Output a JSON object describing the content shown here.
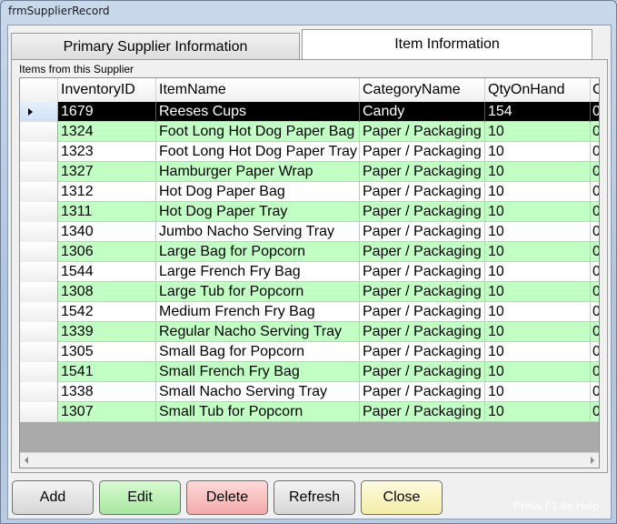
{
  "window": {
    "title": "frmSupplierRecord"
  },
  "tabs": [
    {
      "label": "Primary Supplier Information",
      "active": false
    },
    {
      "label": "Item Information",
      "active": true
    }
  ],
  "group": {
    "label": "Items from this Supplier"
  },
  "grid": {
    "columns": [
      "InventoryID",
      "ItemName",
      "CategoryName",
      "QtyOnHand",
      "C"
    ],
    "rows": [
      [
        "1679",
        "Reeses Cups",
        "Candy",
        "154",
        "0"
      ],
      [
        "1324",
        "Foot Long Hot Dog Paper Bag",
        "Paper / Packaging",
        "10",
        "0"
      ],
      [
        "1323",
        "Foot Long Hot Dog Paper Tray",
        "Paper / Packaging",
        "10",
        "0"
      ],
      [
        "1327",
        "Hamburger Paper Wrap",
        "Paper / Packaging",
        "10",
        "0"
      ],
      [
        "1312",
        "Hot Dog Paper Bag",
        "Paper / Packaging",
        "10",
        "0"
      ],
      [
        "1311",
        "Hot Dog Paper Tray",
        "Paper / Packaging",
        "10",
        "0"
      ],
      [
        "1340",
        "Jumbo Nacho Serving Tray",
        "Paper / Packaging",
        "10",
        "0"
      ],
      [
        "1306",
        "Large Bag for Popcorn",
        "Paper / Packaging",
        "10",
        "0"
      ],
      [
        "1544",
        "Large French Fry Bag",
        "Paper / Packaging",
        "10",
        "0"
      ],
      [
        "1308",
        "Large Tub for Popcorn",
        "Paper / Packaging",
        "10",
        "0"
      ],
      [
        "1542",
        "Medium French Fry Bag",
        "Paper / Packaging",
        "10",
        "0"
      ],
      [
        "1339",
        "Regular Nacho Serving Tray",
        "Paper / Packaging",
        "10",
        "0"
      ],
      [
        "1305",
        "Small Bag for Popcorn",
        "Paper / Packaging",
        "10",
        "0"
      ],
      [
        "1541",
        "Small French Fry Bag",
        "Paper / Packaging",
        "10",
        "0"
      ],
      [
        "1338",
        "Small Nacho Serving Tray",
        "Paper / Packaging",
        "10",
        "0"
      ],
      [
        "1307",
        "Small Tub for Popcorn",
        "Paper / Packaging",
        "10",
        "0"
      ]
    ]
  },
  "buttons": {
    "add": "Add",
    "edit": "Edit",
    "delete": "Delete",
    "refresh": "Refresh",
    "close": "Close"
  },
  "status": {
    "help": "Press F1 for Help"
  },
  "colors": {
    "alt_row": "#c2ffc4",
    "selected_row": "#000000",
    "edit_button": "#a8e6a0",
    "delete_button": "#f2aaaa",
    "close_button": "#f3eda6"
  },
  "icons": {
    "row_pointer": "row-pointer-icon",
    "scroll_left": "scroll-left-icon",
    "scroll_right": "scroll-right-icon"
  }
}
